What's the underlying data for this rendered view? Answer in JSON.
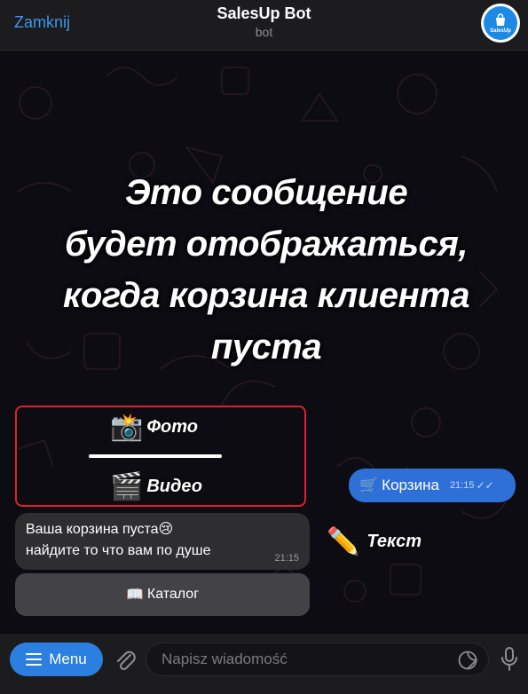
{
  "header": {
    "close_label": "Zamknij",
    "title": "SalesUp Bot",
    "subtitle": "bot",
    "avatar_text": "SalesUp",
    "avatar_icon": "shopping-bag-icon"
  },
  "caption": {
    "line1": "Это сообщение",
    "line2": "будет отображаться,",
    "line3": "когда корзина клиента",
    "line4": "пуста"
  },
  "annotations": {
    "photo_emoji": "📸",
    "photo_label": "Фото",
    "video_emoji": "🎬",
    "video_label": "Видео",
    "text_emoji": "✏️",
    "text_label": "Текст",
    "box_color": "#e0202a"
  },
  "messages": {
    "outgoing": {
      "emoji": "🛒",
      "text": "Корзина",
      "time": "21:15",
      "checks": "✓✓"
    },
    "incoming": {
      "line1_text": "Ваша корзина пуста",
      "line1_emoji": "😢",
      "line2": "найдите то что вам по душе",
      "time": "21:15"
    },
    "keyboard_button": {
      "emoji": "📖",
      "label": "Каталог"
    }
  },
  "input_bar": {
    "menu_label": "Menu",
    "placeholder": "Napisz wiadomość",
    "icons": [
      "menu-lines-icon",
      "paperclip-icon",
      "sticker-icon",
      "microphone-icon"
    ]
  },
  "colors": {
    "accent": "#2b7fe0",
    "outgoing_bubble": "#2f6fd8",
    "header_link": "#3b95f0"
  }
}
